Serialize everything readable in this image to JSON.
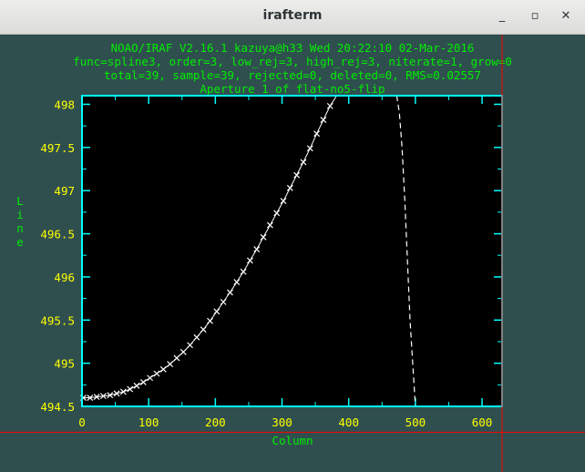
{
  "window": {
    "title": "irafterm",
    "minimize_glyph": "_",
    "maximize_glyph": "▫",
    "close_glyph": "✕"
  },
  "header_lines": [
    "NOAO/IRAF V2.16.1 kazuya@h33 Wed 20:22:10 02-Mar-2016",
    "func=spline3, order=3, low_rej=3, high_rej=3, niterate=1, grow=0",
    "total=39, sample=39, rejected=0, deleted=0, RMS=0.02557",
    "Aperture 1 of flat-no5-flip"
  ],
  "colors": {
    "background": "#2f4f4f",
    "header_text": "#00ee00",
    "tick_labels": "#ffff00",
    "axis_frame": "#00ffff",
    "plot_bg": "#000000",
    "points": "#ffffff",
    "cursor": "#ff0000"
  },
  "chart_data": {
    "type": "scatter",
    "xlabel": "Column",
    "ylabel": "Line",
    "xlim": [
      0,
      630
    ],
    "ylim": [
      494.5,
      498.1
    ],
    "xticks": [
      "0",
      "100",
      "200",
      "300",
      "400",
      "500",
      "600"
    ],
    "yticks": [
      "494.5",
      "495",
      "495.5",
      "496",
      "496.5",
      "497",
      "497.5",
      "498"
    ],
    "grid": false,
    "series": [
      {
        "marker": "x",
        "x": [
          2,
          12,
          22,
          32,
          42,
          52,
          62,
          72,
          82,
          92,
          102,
          112,
          122,
          132,
          142,
          152,
          162,
          172,
          182,
          192,
          202,
          212,
          222,
          232,
          242,
          252,
          262,
          272,
          282,
          292,
          302,
          312,
          322,
          332,
          342,
          352,
          362,
          372,
          382
        ],
        "y": [
          494.6,
          494.6,
          494.61,
          494.62,
          494.63,
          494.65,
          494.67,
          494.7,
          494.74,
          494.78,
          494.83,
          494.88,
          494.93,
          494.99,
          495.06,
          495.13,
          495.21,
          495.3,
          495.39,
          495.49,
          495.6,
          495.71,
          495.82,
          495.94,
          496.06,
          496.19,
          496.32,
          496.46,
          496.6,
          496.74,
          496.88,
          497.03,
          497.18,
          497.33,
          497.49,
          497.66,
          497.82,
          497.98,
          498.14
        ]
      }
    ],
    "fit_line": {
      "style": "dashed",
      "x": [
        472,
        476,
        480,
        484,
        488,
        492,
        496,
        500
      ],
      "y": [
        498.2,
        497.9,
        497.5,
        496.9,
        496.2,
        495.5,
        495.0,
        494.5
      ]
    },
    "cursor": {
      "x": 630,
      "y": 494.2
    }
  }
}
